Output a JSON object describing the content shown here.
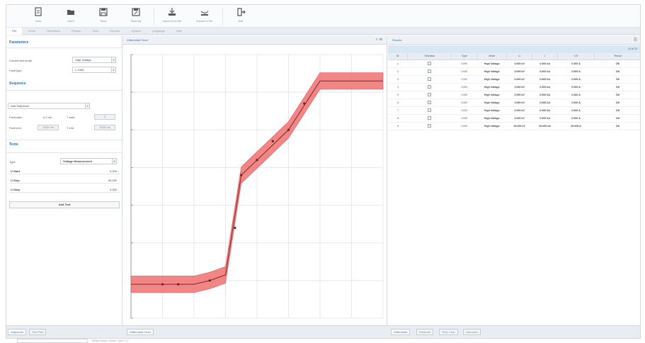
{
  "toolbar": {
    "buttons": [
      {
        "icon": "new-file-icon",
        "label": "New"
      },
      {
        "icon": "open-folder-icon",
        "label": "Open"
      },
      {
        "icon": "save-icon",
        "label": "Save"
      },
      {
        "icon": "save-as-icon",
        "label": "Save As"
      },
      {
        "icon": "import-icon",
        "label": "Import from file"
      },
      {
        "icon": "export-icon",
        "label": "Export to file"
      },
      {
        "icon": "exit-icon",
        "label": "Exit"
      }
    ]
  },
  "ribbon_tabs": [
    "File",
    "Home",
    "Simulation",
    "Graphs",
    "Tools",
    "Reports",
    "Options",
    "Language",
    "Help"
  ],
  "left": {
    "parameters_title": "Parameters",
    "params": [
      {
        "label": "Current test mode",
        "value": "High Voltage"
      },
      {
        "label": "Fault type",
        "value": "L-GND"
      }
    ],
    "sequence_title": "Sequence",
    "sequence_select": "Add Sequence",
    "seq_fields": [
      {
        "label": "Fault start",
        "value": "0.0 ms",
        "label2": "T start",
        "value2": "0"
      },
      {
        "label": "Fault end",
        "value": "1000 ms",
        "label2": "T end",
        "value2": "1000 ms"
      }
    ],
    "tests_title": "Tests",
    "type_label": "Type",
    "type_value": "Voltage Measurement",
    "test_fields": [
      {
        "label": "U Start",
        "value": "0.000"
      },
      {
        "label": "U Step",
        "value": "50.000"
      },
      {
        "label": "U Stop",
        "value": "0.000"
      }
    ],
    "add_button": "Add Test"
  },
  "chart_panel": {
    "title": "Differential Chart",
    "tools": "⌕ ☰"
  },
  "table_panel": {
    "title": "Results",
    "pin_icon": "☰",
    "summary": "13 of 13",
    "columns": [
      "Nr",
      "Selection",
      "Type",
      "Mode",
      "U",
      "I",
      "I×K",
      "Result"
    ],
    "rows": [
      {
        "nr": "1",
        "type": "0.000",
        "mode": "High Voltage",
        "u": "0.000 kV",
        "i": "0.000 kA",
        "ik": "0.000 A",
        "res": "OK"
      },
      {
        "nr": "2",
        "type": "0.000",
        "mode": "High Voltage",
        "u": "0.000 kV",
        "i": "0.000 kA",
        "ik": "0.000 A",
        "res": "OK"
      },
      {
        "nr": "3",
        "type": "0.000",
        "mode": "High Voltage",
        "u": "0.000 kV",
        "i": "0.000 kA",
        "ik": "0.000 A",
        "res": "OK"
      },
      {
        "nr": "4",
        "type": "0.000",
        "mode": "High Voltage",
        "u": "0.000 kV",
        "i": "0.000 kA",
        "ik": "0.000 A",
        "res": "OK"
      },
      {
        "nr": "5",
        "type": "0.000",
        "mode": "High Voltage",
        "u": "0.000 kV",
        "i": "0.000 kA",
        "ik": "0.000 A",
        "res": "OK"
      },
      {
        "nr": "6",
        "type": "0.000",
        "mode": "High Voltage",
        "u": "0.000 kV",
        "i": "0.000 kA",
        "ik": "0.000 A",
        "res": "OK"
      },
      {
        "nr": "7",
        "type": "0.000",
        "mode": "High Voltage",
        "u": "0.000 kV",
        "i": "0.000 kA",
        "ik": "0.000 A",
        "res": "OK"
      },
      {
        "nr": "8",
        "type": "0.000",
        "mode": "High Voltage",
        "u": "0.000 kV",
        "i": "0.000 kA",
        "ik": "0.000 A",
        "res": "OK"
      },
      {
        "nr": "9",
        "type": "0.000",
        "mode": "High Voltage",
        "u": "00.000 kV",
        "i": "00.000 kA",
        "ik": "00.000 A",
        "res": "OK"
      }
    ]
  },
  "bottom_tabs": {
    "left": [
      "Sequence",
      "Test Plan"
    ],
    "chart": [
      "Differential Chart"
    ],
    "table": [
      "Differential",
      "Restraint",
      "Time Char.",
      "Harmonic"
    ]
  },
  "status": {
    "text": "Ready  Device: Online  |  Test  |  1.0"
  },
  "chart_data": {
    "type": "line",
    "title": "",
    "xlabel": "",
    "ylabel": "",
    "xlim": [
      0,
      8
    ],
    "ylim": [
      0,
      7
    ],
    "grid": true,
    "line_color": "#7a2a2a",
    "band_color": "#f07070",
    "band_width": 0.22,
    "points": [
      [
        0,
        0.9
      ],
      [
        1,
        0.9
      ],
      [
        2,
        0.9
      ],
      [
        2.5,
        1.0
      ],
      [
        3,
        1.15
      ],
      [
        3.5,
        3.8
      ],
      [
        4,
        4.2
      ],
      [
        5,
        5.0
      ],
      [
        6,
        6.3
      ],
      [
        7,
        6.3
      ],
      [
        8,
        6.3
      ]
    ],
    "markers": [
      [
        1,
        0.9
      ],
      [
        1.5,
        0.9
      ],
      [
        2.5,
        1.0
      ],
      [
        3.3,
        2.4
      ],
      [
        3.5,
        3.8
      ],
      [
        4,
        4.2
      ],
      [
        4.5,
        4.7
      ],
      [
        5,
        5.0
      ],
      [
        5.5,
        5.7
      ]
    ]
  }
}
